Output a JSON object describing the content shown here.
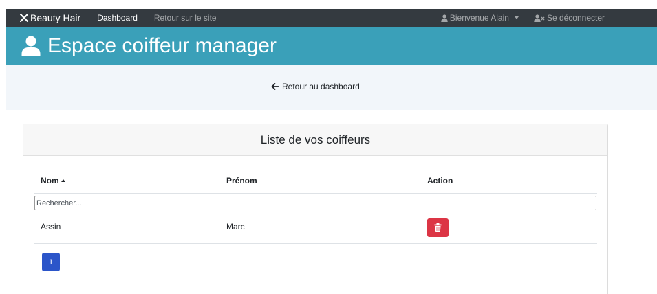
{
  "navbar": {
    "brand": "Beauty Hair",
    "links": [
      {
        "label": "Dashboard",
        "active": true
      },
      {
        "label": "Retour sur le site",
        "active": false
      }
    ],
    "welcome": "Bienvenue Alain",
    "logout": "Se déconnecter"
  },
  "header": {
    "title": "Espace coiffeur manager",
    "icon": "user-icon",
    "background": "#3aa0b9"
  },
  "back": {
    "label": "Retour au dashboard",
    "icon": "arrow-left-icon"
  },
  "card": {
    "title": "Liste de vos coiffeurs",
    "columns": {
      "nom": "Nom",
      "prenom": "Prénom",
      "action": "Action"
    },
    "search_placeholder": "Rechercher...",
    "rows": [
      {
        "nom": "Assin",
        "prenom": "Marc",
        "action_icon": "trash-icon"
      }
    ],
    "pagination": {
      "current": "1"
    }
  },
  "colors": {
    "navbar": "#343a40",
    "accent": "#3aa0b9",
    "danger": "#dc3545",
    "primary": "#2b55c9"
  }
}
